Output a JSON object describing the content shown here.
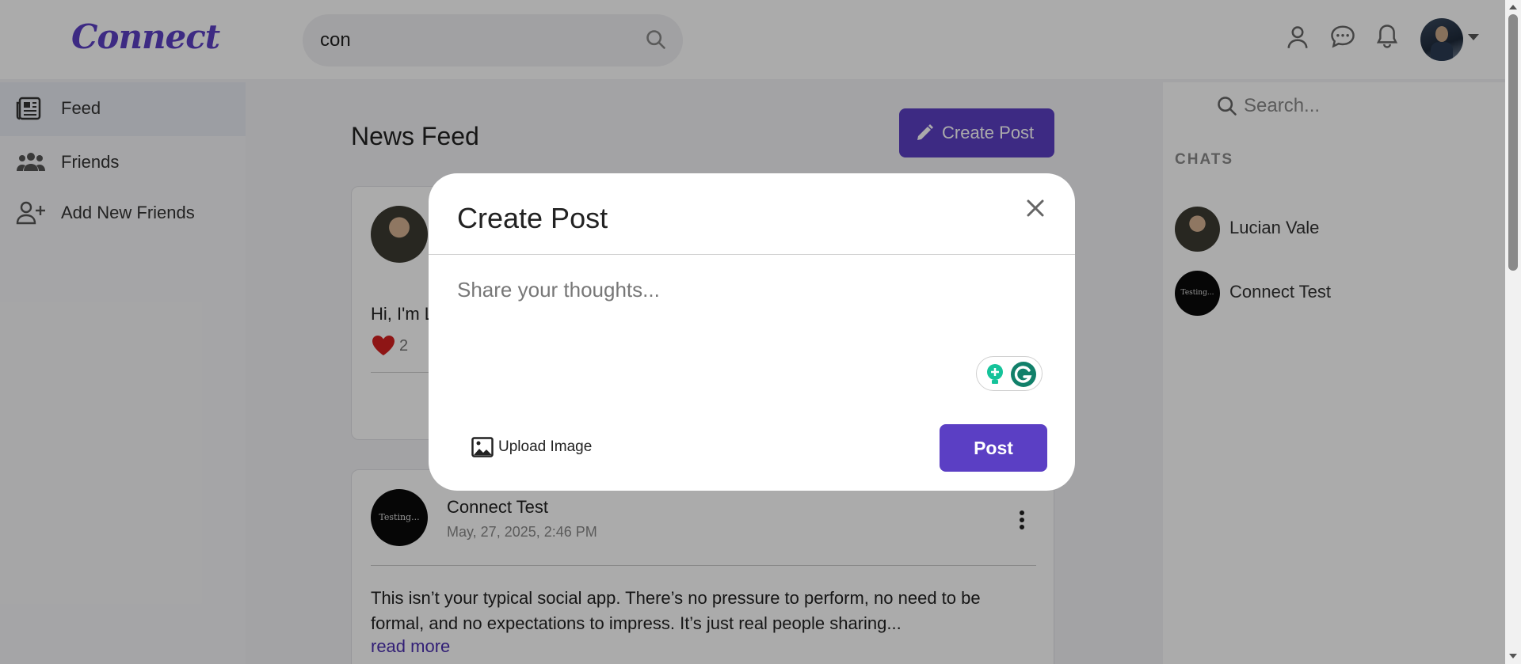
{
  "app": {
    "logo": "Connect"
  },
  "header": {
    "search_value": "con",
    "icons": [
      "search-icon",
      "profile-icon",
      "chat-icon",
      "bell-icon",
      "caret-down-icon"
    ]
  },
  "sidebar": {
    "items": [
      {
        "label": "Feed",
        "icon": "newspaper-icon",
        "active": true
      },
      {
        "label": "Friends",
        "icon": "users-icon",
        "active": false
      },
      {
        "label": "Add New Friends",
        "icon": "user-plus-icon",
        "active": false
      }
    ]
  },
  "feed": {
    "title": "News Feed",
    "create_post_label": "Create Post",
    "posts": [
      {
        "text_preview": "Hi, I'm L",
        "likes": "2"
      },
      {
        "author": "Connect Test",
        "avatar_text": "Testing...",
        "date": "May, 27, 2025, 2:46 PM",
        "body": "This isn’t your typical social app. There’s no pressure to perform, no need to be formal, and no expectations to impress. It’s just real people sharing...",
        "read_more": "read more"
      }
    ]
  },
  "chats": {
    "search_placeholder": "Search...",
    "heading": "CHATS",
    "items": [
      {
        "name": "Lucian Vale"
      },
      {
        "name": "Connect Test",
        "avatar_text": "Testing..."
      }
    ]
  },
  "modal": {
    "title": "Create Post",
    "placeholder": "Share your thoughts...",
    "upload_label": "Upload Image",
    "post_label": "Post"
  },
  "colors": {
    "brand": "#5b3fc4",
    "like": "#d42020",
    "link": "#4b2fb0"
  }
}
